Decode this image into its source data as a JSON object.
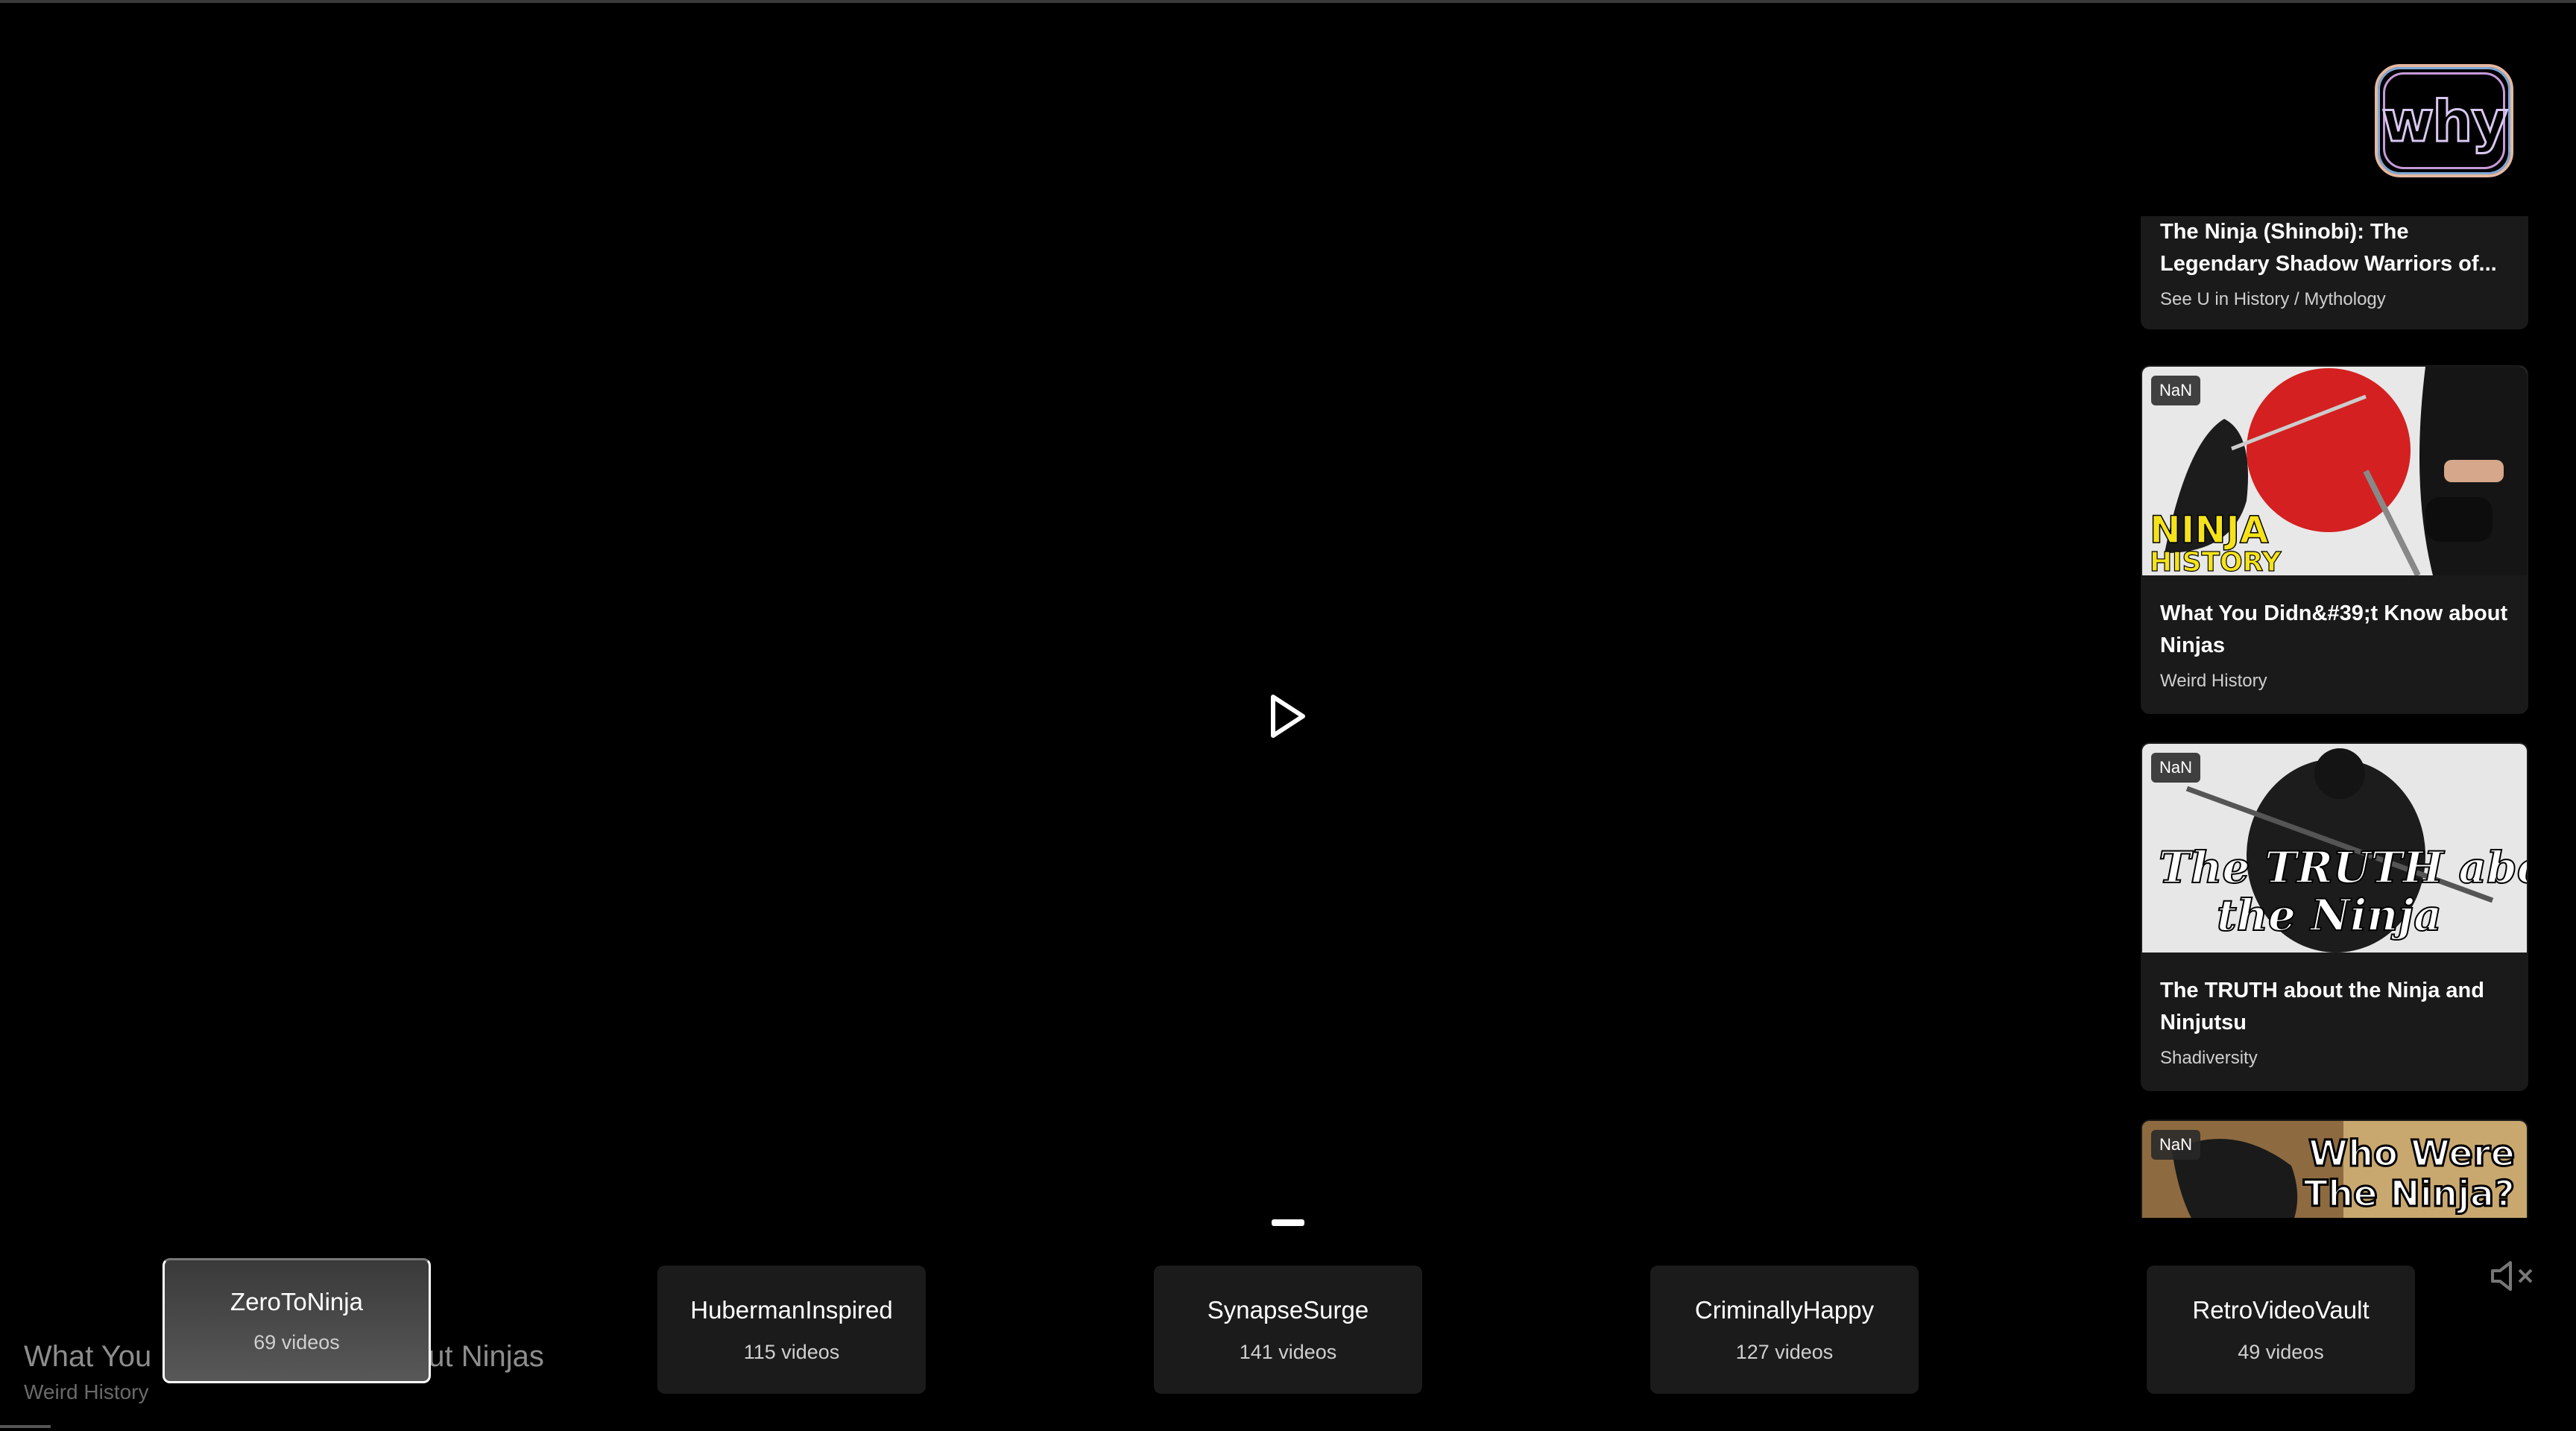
{
  "logo": {
    "text": "why"
  },
  "player": {
    "play_icon": "play-icon",
    "mute_icon": "muted-speaker-icon"
  },
  "background_video": {
    "title_start": "What You",
    "title_end": "out Ninjas",
    "channel": "Weird History"
  },
  "feed": {
    "items": [
      {
        "title": "The Ninja (Shinobi): The Legendary Shadow Warriors of...",
        "channel": "See U in History / Mythology"
      },
      {
        "badge": "NaN",
        "thumb_text_1": "NINJA",
        "thumb_text_2": "HISTORY",
        "title": "What You Didn&#39;t Know about Ninjas",
        "channel": "Weird History"
      },
      {
        "badge": "NaN",
        "thumb_text_1": "The TRUTH about",
        "thumb_text_2": "the Ninja",
        "title": "The TRUTH about the Ninja and Ninjutsu",
        "channel": "Shadiversity"
      },
      {
        "badge": "NaN",
        "thumb_text_1": "Who Were",
        "thumb_text_2": "The Ninja?"
      }
    ]
  },
  "channels": [
    {
      "name": "ZeroToNinja",
      "count": "69 videos"
    },
    {
      "name": "HubermanInspired",
      "count": "115 videos"
    },
    {
      "name": "SynapseSurge",
      "count": "141 videos"
    },
    {
      "name": "CriminallyHappy",
      "count": "127 videos"
    },
    {
      "name": "RetroVideoVault",
      "count": "49 videos"
    }
  ],
  "colors": {
    "background": "#000000",
    "card": "#1a1a1a",
    "active_channel_border": "#ffffff"
  }
}
